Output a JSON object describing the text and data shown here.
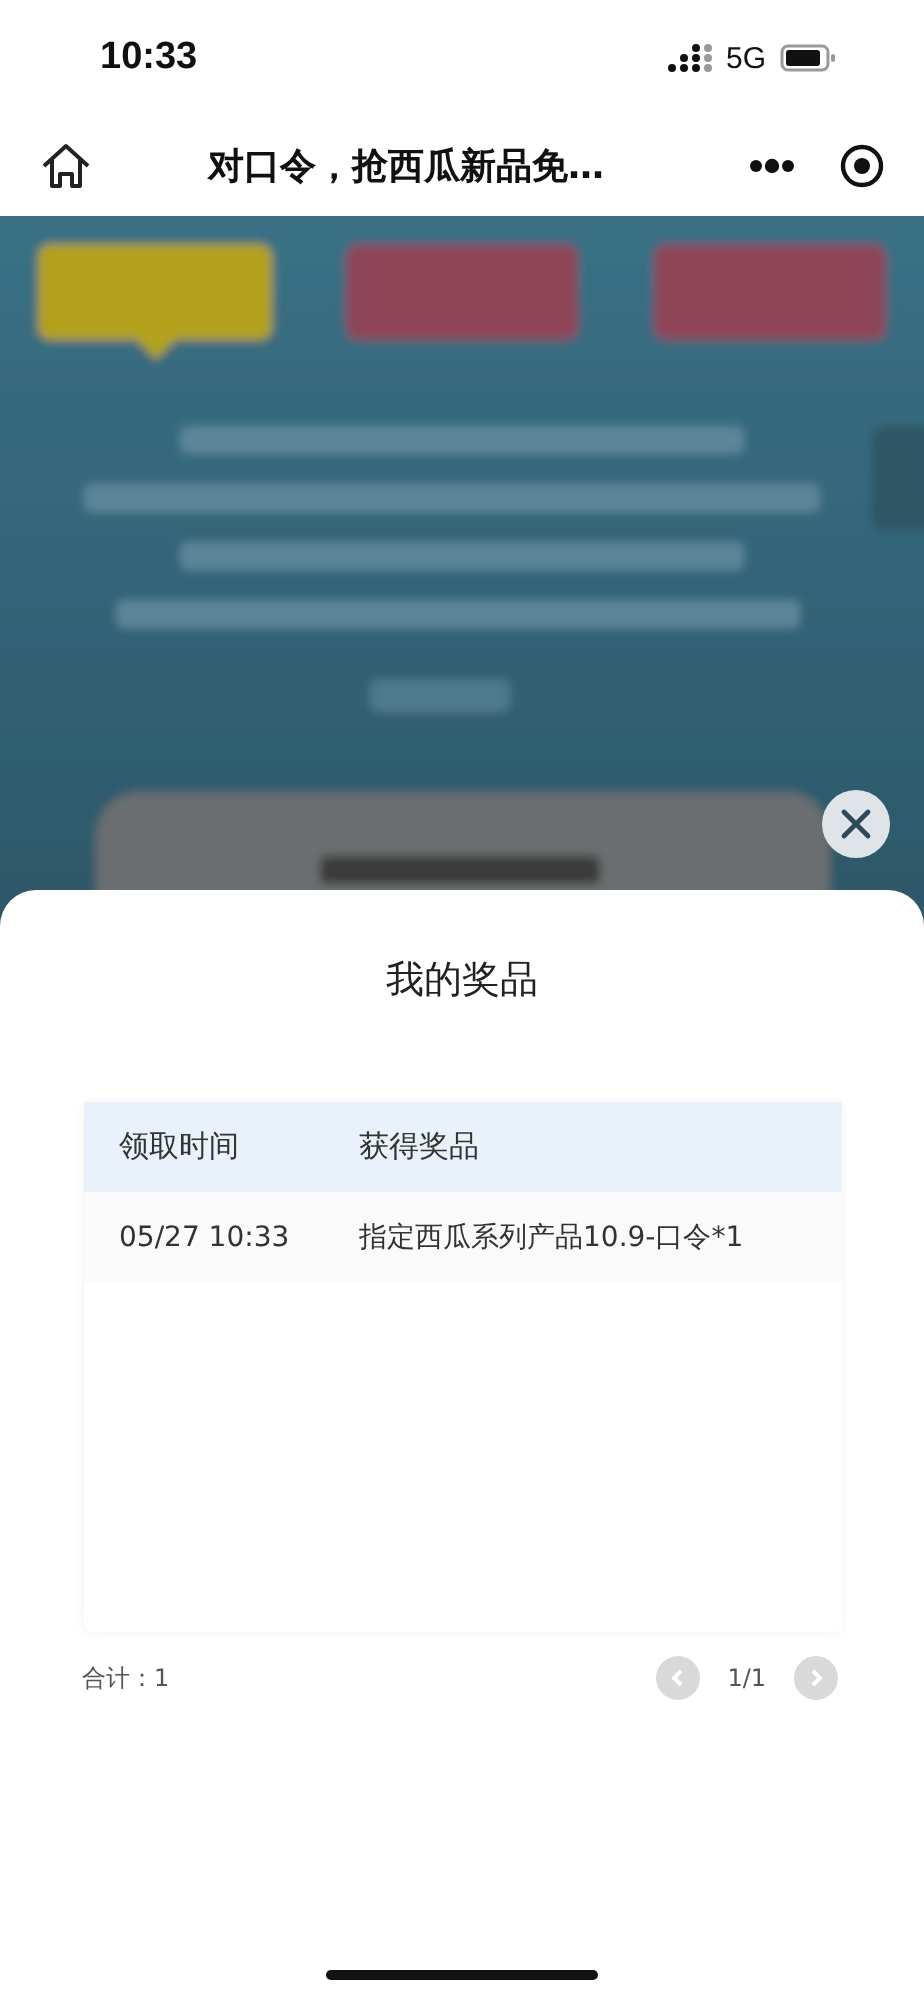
{
  "status_bar": {
    "time": "10:33",
    "network": "5G"
  },
  "nav_bar": {
    "title": "对口令，抢西瓜新品免…"
  },
  "prize_modal": {
    "title": "我的奖品",
    "table": {
      "columns": [
        "领取时间",
        "获得奖品"
      ],
      "rows": [
        {
          "time": "05/27 10:33",
          "prize": "指定西瓜系列产品10.9-口令*1"
        }
      ]
    },
    "total": "合计：1",
    "pager": {
      "page": "1/1",
      "prev": {
        "disabled": true
      },
      "next": {
        "disabled": true
      }
    }
  }
}
